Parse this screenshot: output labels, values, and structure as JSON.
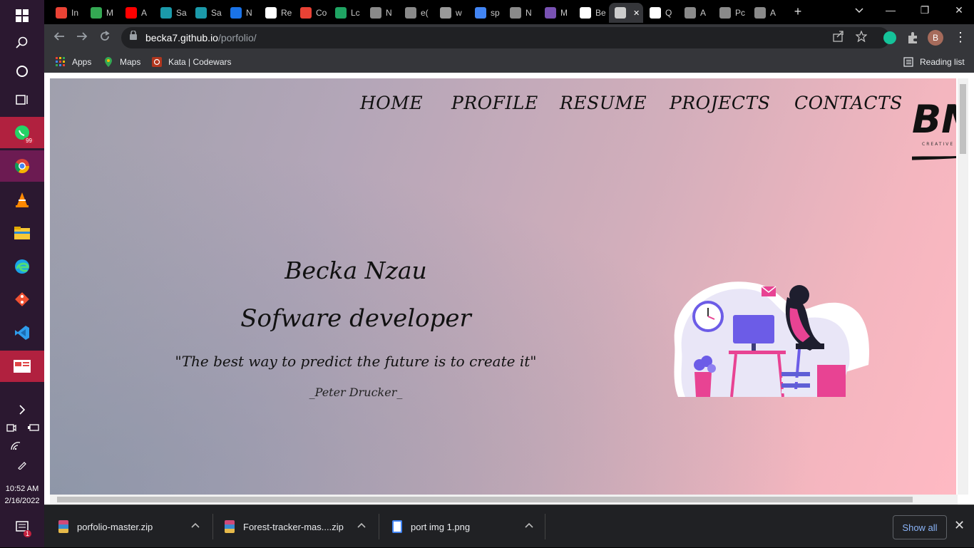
{
  "taskbar": {
    "time": "10:52 AM",
    "date": "2/16/2022",
    "whatsapp_badge": "99",
    "notification_badge": "1",
    "icons": [
      "windows-start",
      "search",
      "cortana",
      "task-view",
      "whatsapp",
      "chrome",
      "vlc",
      "file-explorer",
      "edge",
      "git",
      "vscode",
      "news"
    ]
  },
  "tabs": [
    {
      "label": "In",
      "icon": "gmail",
      "color": "#ea4335"
    },
    {
      "label": "M",
      "icon": "meet",
      "color": "#34a853"
    },
    {
      "label": "A",
      "icon": "youtube",
      "color": "#ff0000"
    },
    {
      "label": "Sa",
      "icon": "flow",
      "color": "#1b9aaa"
    },
    {
      "label": "Sa",
      "icon": "flow",
      "color": "#1b9aaa"
    },
    {
      "label": "N",
      "icon": "calendar",
      "color": "#1a73e8"
    },
    {
      "label": "Re",
      "icon": "replit",
      "color": "#ffffff"
    },
    {
      "label": "Co",
      "icon": "colorful",
      "color": "#e94235"
    },
    {
      "label": "Lc",
      "icon": "w-icon",
      "color": "#1fa463"
    },
    {
      "label": "N",
      "icon": "globe",
      "color": "#8a8a8a"
    },
    {
      "label": "e(",
      "icon": "globe",
      "color": "#8a8a8a"
    },
    {
      "label": "w",
      "icon": "openai",
      "color": "#9a9a9a"
    },
    {
      "label": "sp",
      "icon": "google",
      "color": "#4285f4"
    },
    {
      "label": "N",
      "icon": "globe",
      "color": "#8a8a8a"
    },
    {
      "label": "M",
      "icon": "bootstrap",
      "color": "#7952b3"
    },
    {
      "label": "Be",
      "icon": "github",
      "color": "#ffffff"
    },
    {
      "label": "",
      "icon": "globe",
      "color": "#cccccc",
      "active": true
    },
    {
      "label": "Q",
      "icon": "font-a",
      "color": "#ffffff"
    },
    {
      "label": "A",
      "icon": "globe",
      "color": "#8a8a8a"
    },
    {
      "label": "Pc",
      "icon": "globe",
      "color": "#8a8a8a"
    },
    {
      "label": "A",
      "icon": "globe",
      "color": "#8a8a8a"
    }
  ],
  "address_bar": {
    "host": "becka7.github.io",
    "path": "/porfolio/"
  },
  "profile_initial": "B",
  "bookmarks": [
    {
      "label": "Apps",
      "icon": "apps-grid-icon"
    },
    {
      "label": "Maps",
      "icon": "maps-pin-icon"
    },
    {
      "label": "Kata | Codewars",
      "icon": "codewars-icon"
    }
  ],
  "reading_list": "Reading list",
  "site": {
    "nav": [
      "HOME",
      "PROFILE",
      "RESUME",
      "PROJECTS",
      "CONTACTS"
    ],
    "logo_text": "BN",
    "logo_sub": "CREATIVE",
    "name": "Becka Nzau",
    "role": "Sofware developer",
    "quote": "\"The best way to predict the future is to create it\"",
    "author": "_Peter Drucker_"
  },
  "downloads": [
    {
      "name": "porfolio-master.zip",
      "type": "zip"
    },
    {
      "name": "Forest-tracker-mas....zip",
      "type": "zip"
    },
    {
      "name": "port img 1.png",
      "type": "png"
    }
  ],
  "show_all": "Show all"
}
